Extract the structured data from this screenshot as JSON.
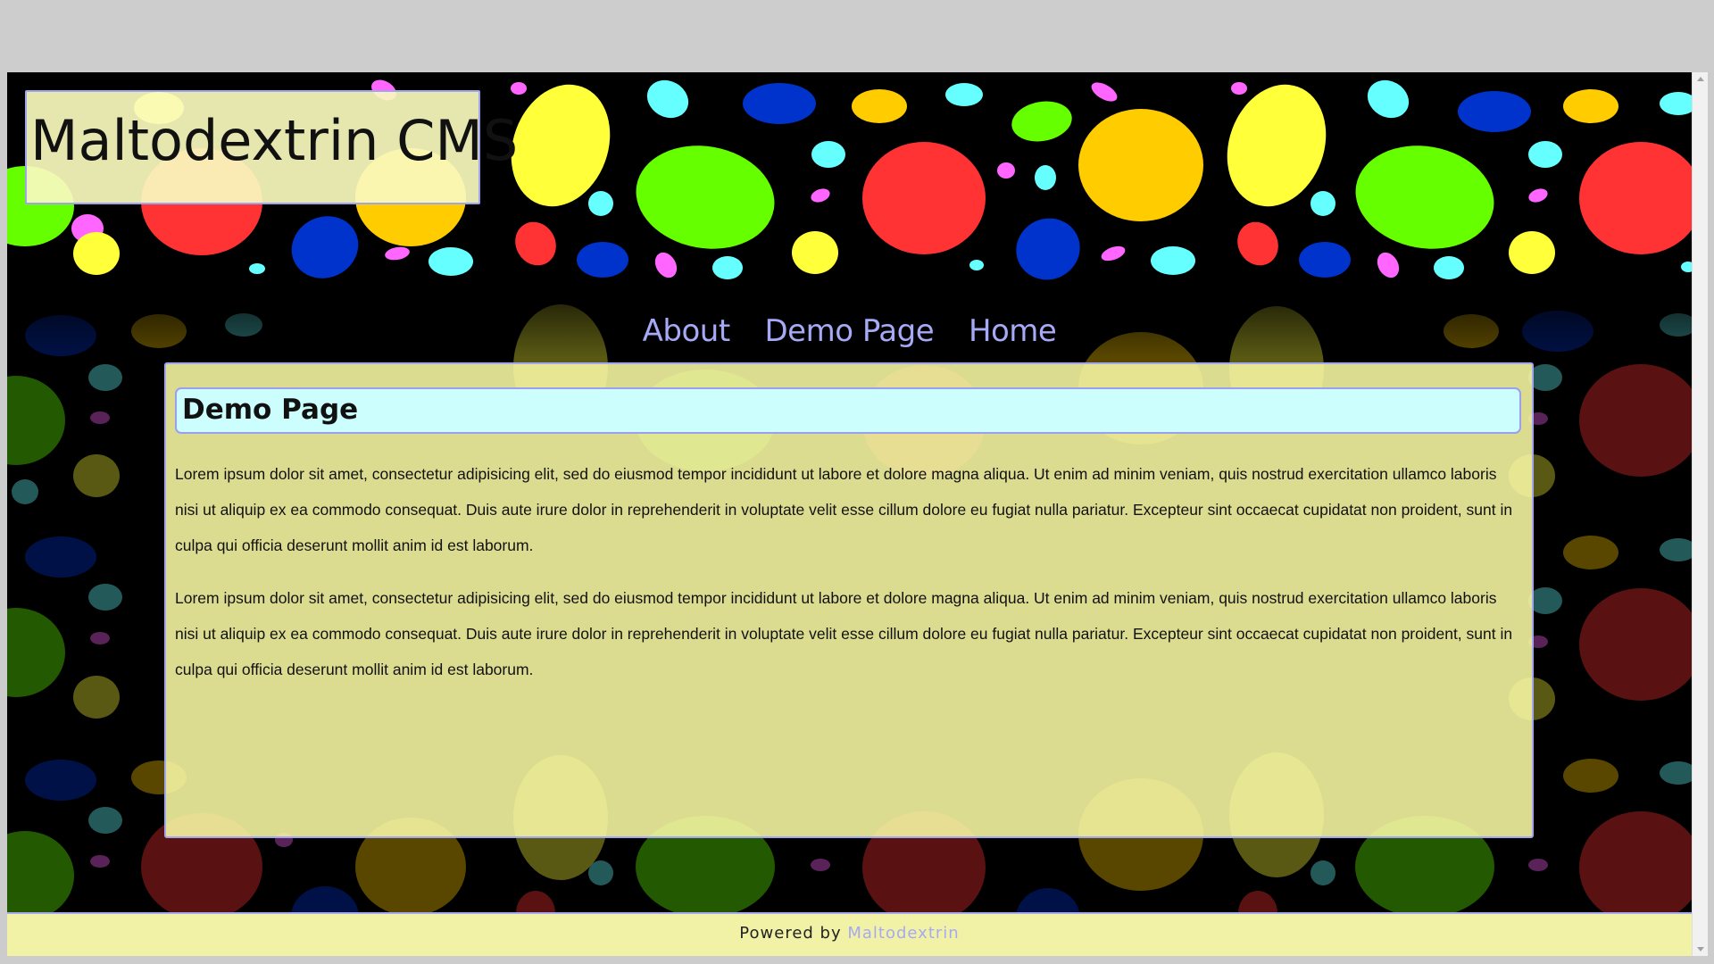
{
  "site": {
    "title": "Maltodextrin CMS"
  },
  "nav": {
    "items": [
      {
        "label": "About"
      },
      {
        "label": "Demo Page"
      },
      {
        "label": "Home"
      }
    ]
  },
  "page": {
    "heading": "Demo Page",
    "paragraphs": [
      "Lorem ipsum dolor sit amet, consectetur adipisicing elit, sed do eiusmod tempor incididunt ut labore et dolore magna aliqua. Ut enim ad minim veniam, quis nostrud exercitation ullamco laboris nisi ut aliquip ex ea commodo consequat. Duis aute irure dolor in reprehenderit in voluptate velit esse cillum dolore eu fugiat nulla pariatur. Excepteur sint occaecat cupidatat non proident, sunt in culpa qui officia deserunt mollit anim id est laborum.",
      "Lorem ipsum dolor sit amet, consectetur adipisicing elit, sed do eiusmod tempor incididunt ut labore et dolore magna aliqua. Ut enim ad minim veniam, quis nostrud exercitation ullamco laboris nisi ut aliquip ex ea commodo consequat. Duis aute irure dolor in reprehenderit in voluptate velit esse cillum dolore eu fugiat nulla pariatur. Excepteur sint occaecat cupidatat non proident, sunt in culpa qui officia deserunt mollit anim id est laborum."
    ]
  },
  "footer": {
    "prefix": "Powered by",
    "link_label": "Maltodextrin"
  },
  "colors": {
    "link": "#a6a9f5",
    "panel_border": "#a2a6ee",
    "heading_bg": "#ccfefe",
    "panel_bg": "#fafaa5",
    "page_bg": "#000000",
    "dot_yellow": "#ffff3a",
    "dot_green": "#66ff00",
    "dot_red": "#ff3333",
    "dot_blue": "#0033cc",
    "dot_cyan": "#66ffff",
    "dot_orange": "#ffcc00",
    "dot_pink": "#ff66ff"
  }
}
